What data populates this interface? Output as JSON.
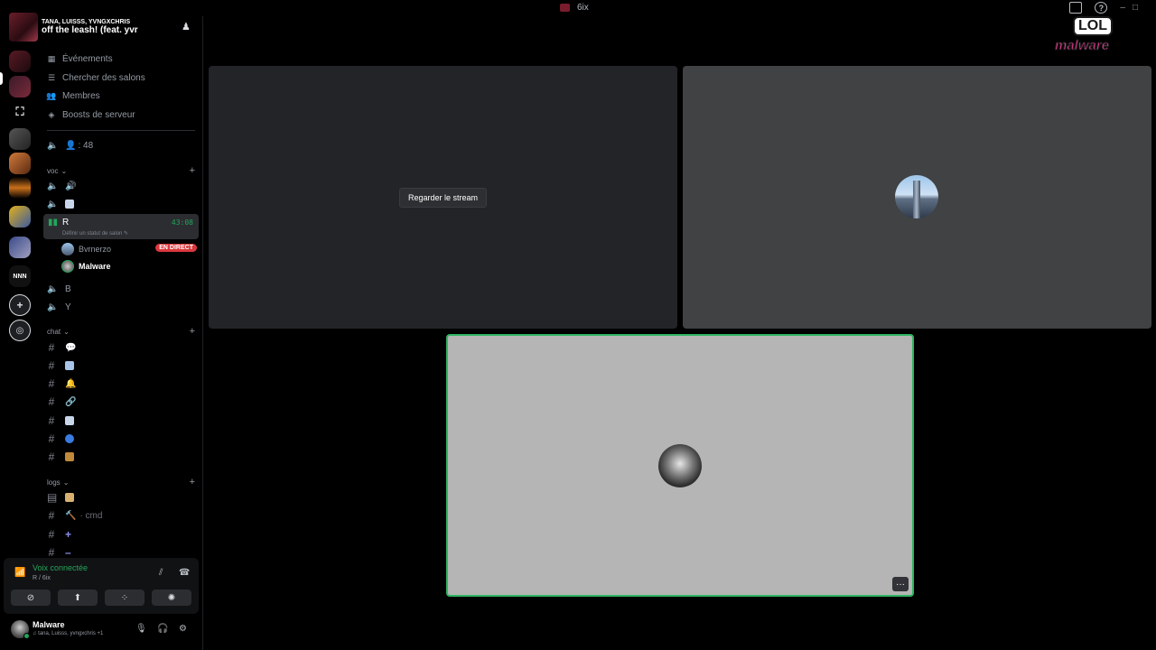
{
  "window": {
    "title": "6ix"
  },
  "now_playing": {
    "artists": "TANA, LUISSS, YVNGXCHRIS",
    "song": "off the leash! (feat. yvr"
  },
  "nav": [
    {
      "label": "Événements",
      "icon": "calendar-icon"
    },
    {
      "label": "Chercher des salons",
      "icon": "channel-browse-icon"
    },
    {
      "label": "Membres",
      "icon": "members-icon"
    },
    {
      "label": "Boosts de serveur",
      "icon": "boost-icon"
    }
  ],
  "member_count_channel": {
    "label": ": 48"
  },
  "categories": {
    "voc": "voc",
    "chat": "chat",
    "logs": "logs"
  },
  "voice_channels": {
    "active": {
      "name": "R",
      "time": "43:08",
      "status": "Définir un statut de salon"
    },
    "b": "B",
    "y": "Y"
  },
  "voice_users": [
    {
      "name": "Bvrnerzo",
      "live": "EN DIRECT"
    },
    {
      "name": "Malware"
    }
  ],
  "log_channels": {
    "cmd": "· cmd"
  },
  "voice_panel": {
    "status": "Voix connectée",
    "sub": "R / 6ix"
  },
  "user_panel": {
    "name": "Malware",
    "activity": "♫ tana, Luisss, yvngxchris +1"
  },
  "stage": {
    "watch_label": "Regarder le stream",
    "more_label": "···"
  },
  "sticker": {
    "top": "LOL",
    "word": "malware"
  },
  "colors": {
    "accent_green": "#23a55a",
    "live_red": "#da373c",
    "speaking_border": "#2fb463"
  }
}
